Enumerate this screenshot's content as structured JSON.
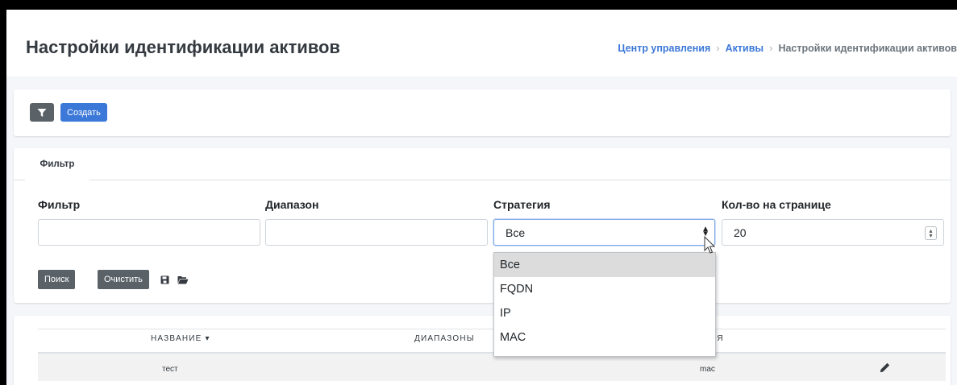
{
  "header": {
    "title": "Настройки идентификации активов",
    "breadcrumb": [
      "Центр управления",
      "Активы",
      "Настройки идентификации активов"
    ]
  },
  "toolbar": {
    "filter_icon": "filter-icon",
    "create_label": "Создать"
  },
  "filter_tab": {
    "label": "Фильтр"
  },
  "filters": {
    "filter": {
      "label": "Фильтр",
      "value": ""
    },
    "range": {
      "label": "Диапазон",
      "value": ""
    },
    "strategy": {
      "label": "Стратегия",
      "value": "Все",
      "options": [
        "Все",
        "FQDN",
        "IP",
        "MAC"
      ],
      "highlighted": "Все"
    },
    "per_page": {
      "label": "Кол-во на странице",
      "value": "20"
    }
  },
  "actions": {
    "search_label": "Поиск",
    "clear_label": "Очистить",
    "save_icon": "save-icon",
    "folder_icon": "folder-open-icon"
  },
  "table": {
    "columns": [
      "НАЗВАНИЕ",
      "ДИАПАЗОНЫ",
      "ИЯ"
    ],
    "rows": [
      {
        "name": "тест",
        "ranges": "",
        "strategy": "mac"
      }
    ]
  },
  "colors": {
    "primary": "#3c78d8",
    "secondary": "#5a6268",
    "background": "#f4f6f9"
  }
}
